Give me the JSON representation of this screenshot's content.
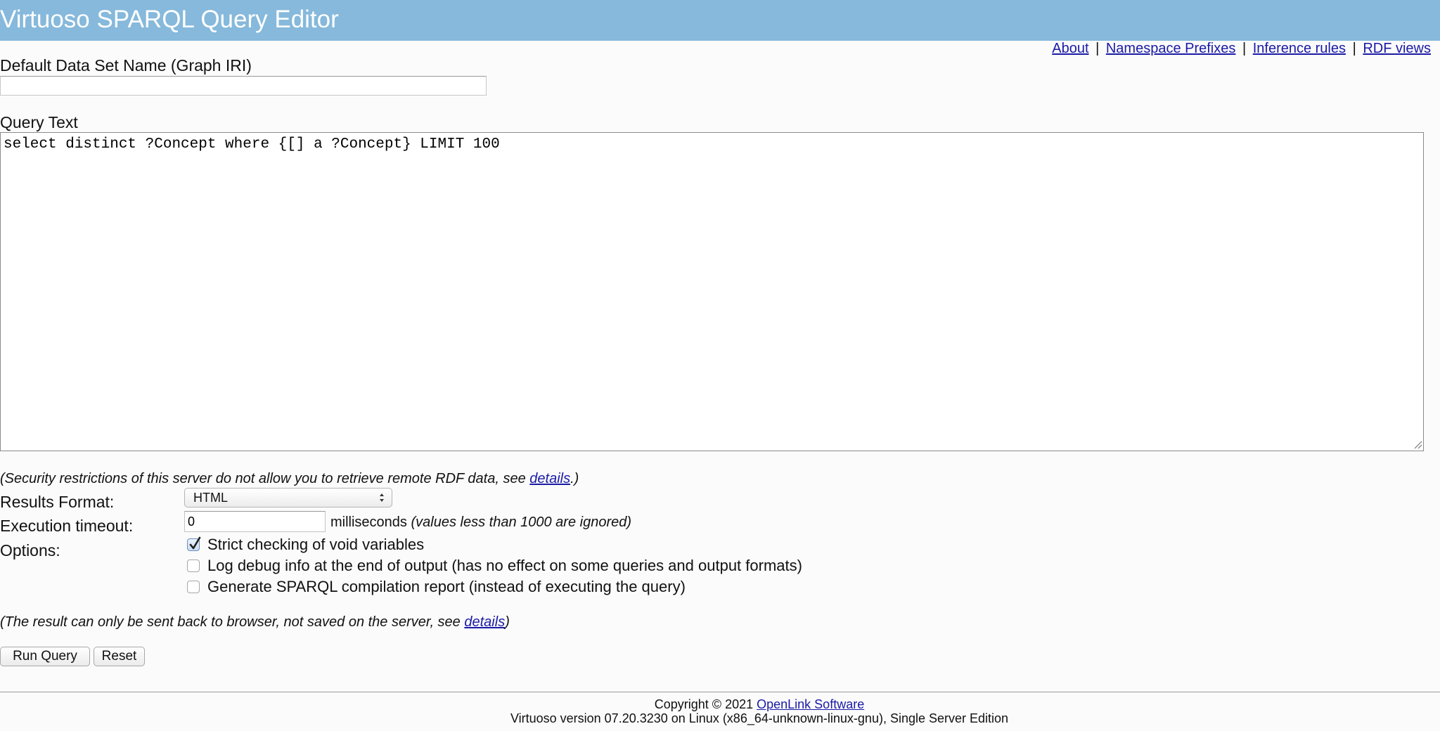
{
  "header": {
    "title": "Virtuoso SPARQL Query Editor",
    "background_color": "#86b9db"
  },
  "top_links": {
    "about": "About",
    "namespace_prefixes": "Namespace Prefixes",
    "inference_rules": "Inference rules",
    "rdf_views": "RDF views",
    "separator": "|"
  },
  "graph": {
    "label": "Default Data Set Name (Graph IRI)",
    "value": ""
  },
  "query": {
    "label": "Query Text",
    "value": "select distinct ?Concept where {[] a ?Concept} LIMIT 100"
  },
  "security_note": {
    "prefix": "(Security restrictions of this server do not allow you to retrieve remote RDF data, see ",
    "link": "details",
    "suffix": ".)"
  },
  "results_format": {
    "label": "Results Format:",
    "selected": "HTML"
  },
  "timeout": {
    "label": "Execution timeout:",
    "value": "0",
    "unit": "milliseconds",
    "hint": "(values less than 1000 are ignored)"
  },
  "options": {
    "label": "Options:",
    "items": [
      {
        "label": "Strict checking of void variables",
        "checked": true
      },
      {
        "label": "Log debug info at the end of output (has no effect on some queries and output formats)",
        "checked": false
      },
      {
        "label": "Generate SPARQL compilation report (instead of executing the query)",
        "checked": false
      }
    ]
  },
  "result_note": {
    "prefix": "(The result can only be sent back to browser, not saved on the server, see ",
    "link": "details",
    "suffix": ")"
  },
  "buttons": {
    "run": "Run Query",
    "reset": "Reset"
  },
  "footer": {
    "copyright_prefix": "Copyright © 2021 ",
    "copyright_link": "OpenLink Software",
    "version": "Virtuoso version 07.20.3230 on Linux (x86_64-unknown-linux-gnu), Single Server Edition"
  }
}
